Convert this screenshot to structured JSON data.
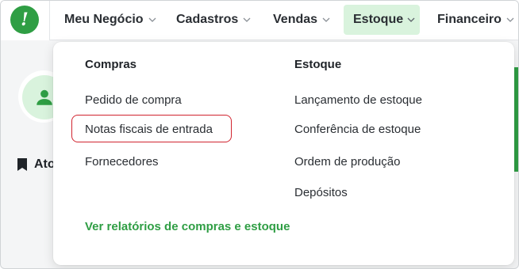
{
  "nav": {
    "logo_glyph": "!",
    "items": [
      {
        "label": "Meu Negócio",
        "active": false
      },
      {
        "label": "Cadastros",
        "active": false
      },
      {
        "label": "Vendas",
        "active": false
      },
      {
        "label": "Estoque",
        "active": true
      },
      {
        "label": "Financeiro",
        "active": false
      }
    ]
  },
  "background": {
    "section_label": "Ato"
  },
  "dropdown": {
    "compras": {
      "title": "Compras",
      "items": [
        "Pedido de compra",
        "Notas fiscais de entrada",
        "Fornecedores"
      ]
    },
    "estoque": {
      "title": "Estoque",
      "items": [
        "Lançamento de estoque",
        "Conferência de estoque",
        "Ordem de produção",
        "Depósitos"
      ]
    },
    "report_link": "Ver relatórios de compras e estoque"
  },
  "colors": {
    "brand_green": "#2f9e44",
    "active_tab_bg": "#d9f3dd",
    "highlight_red": "#d1242f"
  },
  "icons": {
    "logo": "exclamation-logo-icon",
    "chevron": "chevron-down-icon",
    "avatar": "user-icon",
    "bookmark": "bookmark-icon"
  }
}
